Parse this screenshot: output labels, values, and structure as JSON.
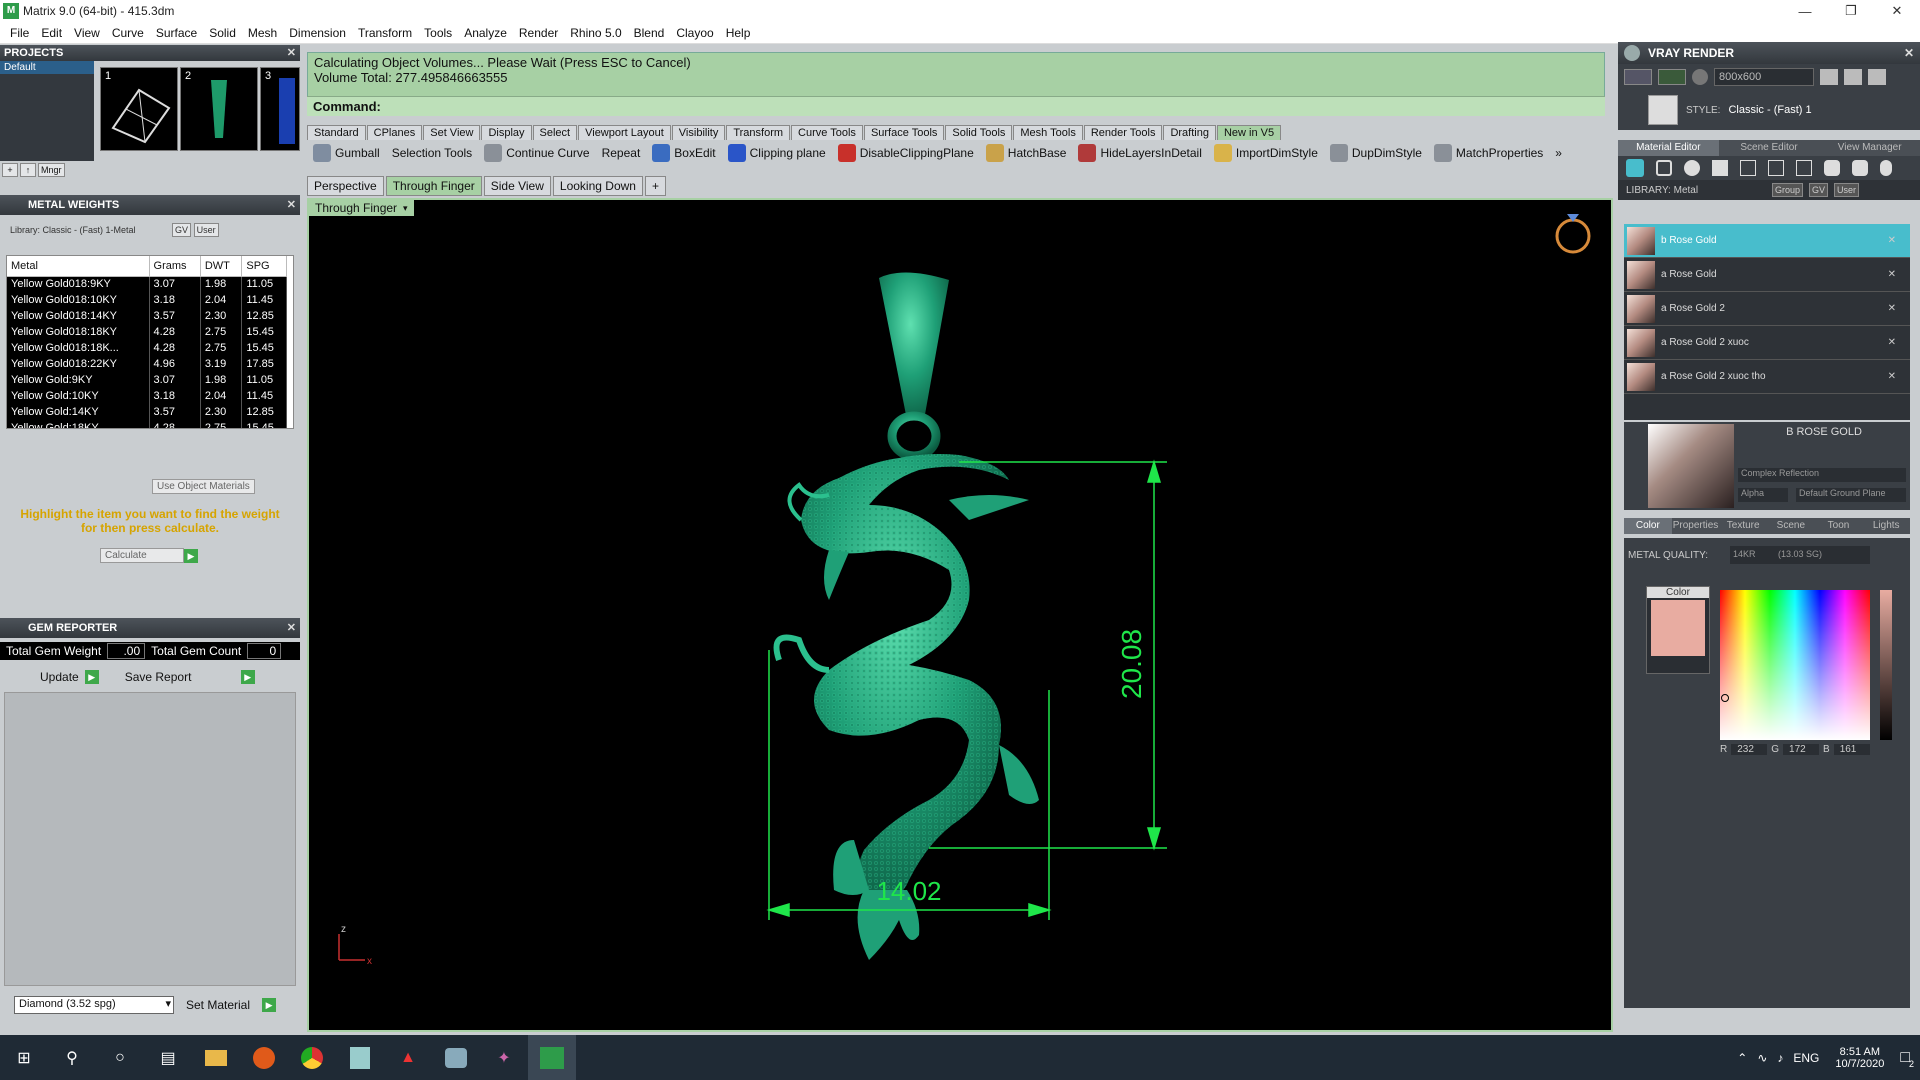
{
  "window": {
    "title": "Matrix 9.0 (64-bit) - 415.3dm",
    "minimize_icon": "minimize-icon",
    "restore_icon": "restore-icon",
    "close_icon": "close-icon"
  },
  "menu": [
    "File",
    "Edit",
    "View",
    "Curve",
    "Surface",
    "Solid",
    "Mesh",
    "Dimension",
    "Transform",
    "Tools",
    "Analyze",
    "Render",
    "Rhino 5.0",
    "Blend",
    "Clayoo",
    "Help"
  ],
  "projects": {
    "title": "PROJECTS",
    "items": [
      "Default"
    ],
    "thumbs": [
      "1",
      "2",
      "3"
    ],
    "mgr_label": "Mngr"
  },
  "metal_weights": {
    "title": "METAL WEIGHTS",
    "library": "Library: Classic - (Fast) 1-Metal",
    "gv": "GV",
    "user": "User",
    "columns": [
      "Metal",
      "Grams",
      "DWT",
      "SPG"
    ],
    "rows": [
      [
        "Yellow Gold018:9KY",
        "3.07",
        "1.98",
        "11.05"
      ],
      [
        "Yellow Gold018:10KY",
        "3.18",
        "2.04",
        "11.45"
      ],
      [
        "Yellow Gold018:14KY",
        "3.57",
        "2.30",
        "12.85"
      ],
      [
        "Yellow Gold018:18KY",
        "4.28",
        "2.75",
        "15.45"
      ],
      [
        "Yellow Gold018:18K...",
        "4.28",
        "2.75",
        "15.45"
      ],
      [
        "Yellow Gold018:22KY",
        "4.96",
        "3.19",
        "17.85"
      ],
      [
        "Yellow Gold:9KY",
        "3.07",
        "1.98",
        "11.05"
      ],
      [
        "Yellow Gold:10KY",
        "3.18",
        "2.04",
        "11.45"
      ],
      [
        "Yellow Gold:14KY",
        "3.57",
        "2.30",
        "12.85"
      ],
      [
        "Yellow Gold:18KY",
        "4.28",
        "2.75",
        "15.45"
      ],
      [
        "Yellow Gold:18KY R...",
        "4.28",
        "2.75",
        "15.45"
      ]
    ],
    "use_object_materials": "Use Object Materials",
    "hint": "Highlight the item you want to find the weight for then press calculate.",
    "calculate": "Calculate"
  },
  "gem_reporter": {
    "title": "GEM REPORTER",
    "total_weight_label": "Total Gem Weight",
    "total_weight": ".00",
    "total_count_label": "Total Gem Count",
    "total_count": "0",
    "update": "Update",
    "save_report": "Save Report",
    "material_select": "Diamond    (3.52 spg)",
    "set_material": "Set Material"
  },
  "command": {
    "line1": "Calculating Object Volumes... Please Wait (Press ESC to Cancel)",
    "line2": "Volume Total: 277.495846663555",
    "prompt": "Command:"
  },
  "toolbar_tabs": [
    "Standard",
    "CPlanes",
    "Set View",
    "Display",
    "Select",
    "Viewport Layout",
    "Visibility",
    "Transform",
    "Curve Tools",
    "Surface Tools",
    "Solid Tools",
    "Mesh Tools",
    "Render Tools",
    "Drafting",
    "New in V5"
  ],
  "tools": [
    {
      "label": "Gumball",
      "icon": "gumball-icon"
    },
    {
      "label": "Selection Tools",
      "icon": "selection-icon"
    },
    {
      "label": "Continue Curve",
      "icon": "curve-icon"
    },
    {
      "label": "Repeat",
      "icon": "repeat-icon"
    },
    {
      "label": "BoxEdit",
      "icon": "boxedit-icon"
    },
    {
      "label": "Clipping plane",
      "icon": "clipping-plane-icon"
    },
    {
      "label": "DisableClippingPlane",
      "icon": "disable-clipping-icon"
    },
    {
      "label": "HatchBase",
      "icon": "hatch-icon"
    },
    {
      "label": "HideLayersInDetail",
      "icon": "hide-layers-icon"
    },
    {
      "label": "ImportDimStyle",
      "icon": "import-dimstyle-icon"
    },
    {
      "label": "DupDimStyle",
      "icon": "dup-dimstyle-icon"
    },
    {
      "label": "MatchProperties",
      "icon": "match-properties-icon"
    }
  ],
  "more_label": "»",
  "view_tabs": [
    "Perspective",
    "Through Finger",
    "Side View",
    "Looking Down"
  ],
  "view_add": "+",
  "viewport": {
    "label": "Through Finger",
    "dim_height": "20.08",
    "dim_width": "14.02",
    "axis_z": "z",
    "axis_x": "x"
  },
  "vray": {
    "title": "VRAY RENDER",
    "resolution": "800x600",
    "style_label": "STYLE:",
    "style_value": "Classic - (Fast) 1",
    "tabs": [
      "Material Editor",
      "Scene Editor",
      "View Manager"
    ],
    "library_label": "LIBRARY: Metal",
    "group": "Group",
    "gv": "GV",
    "user": "User",
    "materials": [
      "b Rose Gold",
      "a Rose Gold",
      "a Rose Gold 2",
      "a Rose Gold 2 xuoc",
      "a Rose Gold 2 xuoc tho"
    ],
    "selected_name": "B ROSE GOLD",
    "reflection": "Complex Reflection",
    "alpha": "Alpha",
    "ground": "Default Ground Plane",
    "prop_tabs": [
      "Color",
      "Properties",
      "Texture",
      "Scene",
      "Toon",
      "Lights"
    ],
    "metal_quality_label": "METAL QUALITY:",
    "metal_quality": "14KR",
    "metal_spg": "(13.03 SG)",
    "color_label": "Color",
    "r_label": "R",
    "r": "232",
    "g_label": "G",
    "g": "172",
    "b_label": "B",
    "b": "161",
    "swatch_color": "#e8aca1"
  },
  "taskbar": {
    "icons": [
      "windows-start-icon",
      "search-icon",
      "cortana-icon",
      "task-view-icon",
      "file-explorer-icon",
      "app-icon",
      "chrome-icon",
      "notepad-icon",
      "rhino-icon",
      "paint-icon",
      "matrix-icon"
    ],
    "lang": "ENG",
    "time": "8:51 AM",
    "date": "10/7/2020",
    "notif_count": "2"
  }
}
